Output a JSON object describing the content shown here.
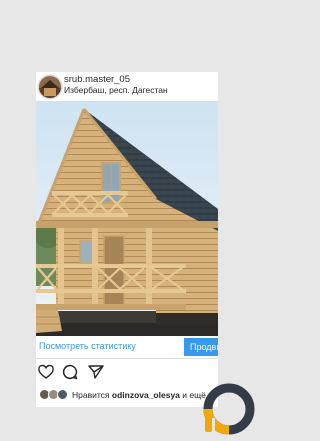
{
  "post": {
    "username": "srub.master_05",
    "location": "Избербаш, респ. Дагестан",
    "cta_link": "Посмотреть статистику",
    "cta_button": "Продвигать",
    "likes_prefix": "Нравится ",
    "likes_user": "odinzova_olesya",
    "likes_suffix": " и ещё"
  },
  "icons": {
    "like": "heart-icon",
    "comment": "comment-icon",
    "share": "paper-plane-icon"
  },
  "colors": {
    "link": "#3897f0",
    "button": "#3897f0",
    "roof": "#3b4750",
    "timber": "#d8b47c",
    "logo_dark": "#333c48",
    "logo_accent": "#f1a80a"
  }
}
